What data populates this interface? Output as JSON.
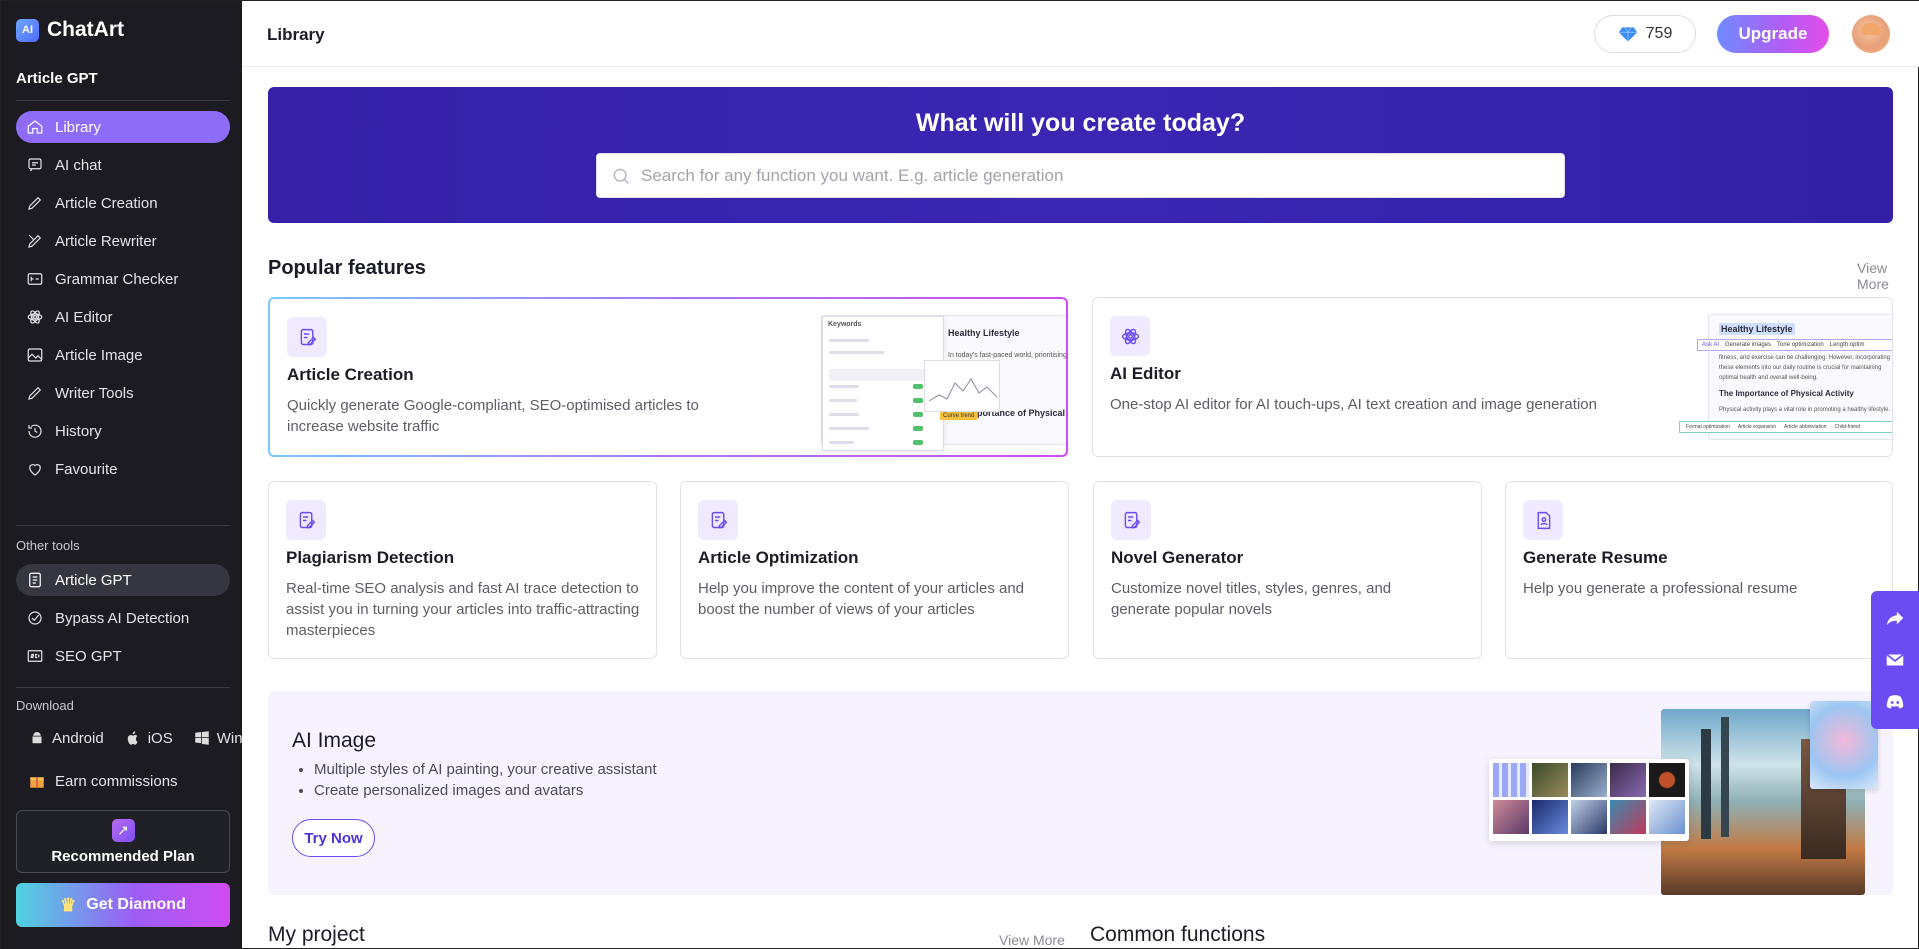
{
  "app": {
    "name": "ChatArt",
    "logo_mark": "AI"
  },
  "sidebar": {
    "section_title": "Article GPT",
    "items": [
      {
        "label": "Library",
        "icon": "home-icon"
      },
      {
        "label": "AI chat",
        "icon": "chat-icon"
      },
      {
        "label": "Article Creation",
        "icon": "pen-icon"
      },
      {
        "label": "Article Rewriter",
        "icon": "rewrite-icon"
      },
      {
        "label": "Grammar Checker",
        "icon": "grammar-icon"
      },
      {
        "label": "AI Editor",
        "icon": "atom-icon"
      },
      {
        "label": "Article Image",
        "icon": "image-icon"
      },
      {
        "label": "Writer Tools",
        "icon": "pencil-icon"
      },
      {
        "label": "History",
        "icon": "history-icon"
      },
      {
        "label": "Favourite",
        "icon": "heart-icon"
      }
    ],
    "other_tools_label": "Other tools",
    "other_tools": [
      {
        "label": "Article GPT",
        "icon": "document-icon"
      },
      {
        "label": "Bypass AI Detection",
        "icon": "check-circle-icon"
      },
      {
        "label": "SEO GPT",
        "icon": "seo-icon"
      }
    ],
    "download_label": "Download",
    "downloads": {
      "android": "Android",
      "ios": "iOS",
      "win": "Win"
    },
    "earn": "Earn commissions",
    "plan": "Recommended Plan",
    "get_diamond": "Get Diamond"
  },
  "header": {
    "title": "Library",
    "gems": "759",
    "upgrade": "Upgrade"
  },
  "hero": {
    "title": "What will you create today?",
    "search_placeholder": "Search for any function you want. E.g. article generation"
  },
  "popular": {
    "title": "Popular features",
    "view_more": "View More",
    "featured": [
      {
        "title": "Article Creation",
        "desc": "Quickly generate Google-compliant, SEO-optimised articles to increase website traffic"
      },
      {
        "title": "AI Editor",
        "desc": "One-stop AI editor for AI touch-ups, AI text creation and image generation"
      }
    ],
    "cards": [
      {
        "title": "Plagiarism Detection",
        "desc": "Real-time SEO analysis and fast AI trace detection to assist you in turning your articles into traffic-attracting masterpieces"
      },
      {
        "title": "Article Optimization",
        "desc": "Help you improve the content of your articles and boost the number of views of your articles"
      },
      {
        "title": "Novel Generator",
        "desc": "Customize novel titles, styles, genres, and generate popular novels"
      },
      {
        "title": "Generate Resume",
        "desc": "Help you generate a professional resume"
      }
    ],
    "preview_left": {
      "heading": "Healthy Lifestyle",
      "text": "In today's fast-paced world, prioritising phys",
      "subheading": "The Importance of Physical Activ",
      "badge": "Curve trend",
      "panel_title": "Keywords"
    },
    "preview_right": {
      "heading": "Healthy Lifestyle",
      "toolbar": [
        "Ask AI",
        "Generate images",
        "Tone optimization",
        "Length optim"
      ],
      "text1": "fitness, and exercise can be challenging. However, incorporating",
      "text2": "these elements into our daily routine is crucial for maintaining",
      "text3": "optimal health and overall well-being.",
      "subheading": "The Importance of Physical Activity",
      "text4": "Physical activity plays a vital role in promoting a healthy lifestyle.",
      "bottom_tools": [
        "Format optimization",
        "Article expansion",
        "Article abbreviation",
        "Child-friend"
      ]
    }
  },
  "ai_image": {
    "title": "AI Image",
    "bullets": [
      "Multiple styles of AI painting, your creative assistant",
      "Create personalized images and avatars"
    ],
    "cta": "Try Now"
  },
  "bottom": {
    "my_project": "My project",
    "view_more": "View More",
    "common_functions": "Common functions"
  },
  "colors": {
    "accent": "#6a4cf2",
    "sidebar_bg": "#1b1b21",
    "hero_bg": "#3620a8",
    "active_nav": "#8f6cf7"
  }
}
